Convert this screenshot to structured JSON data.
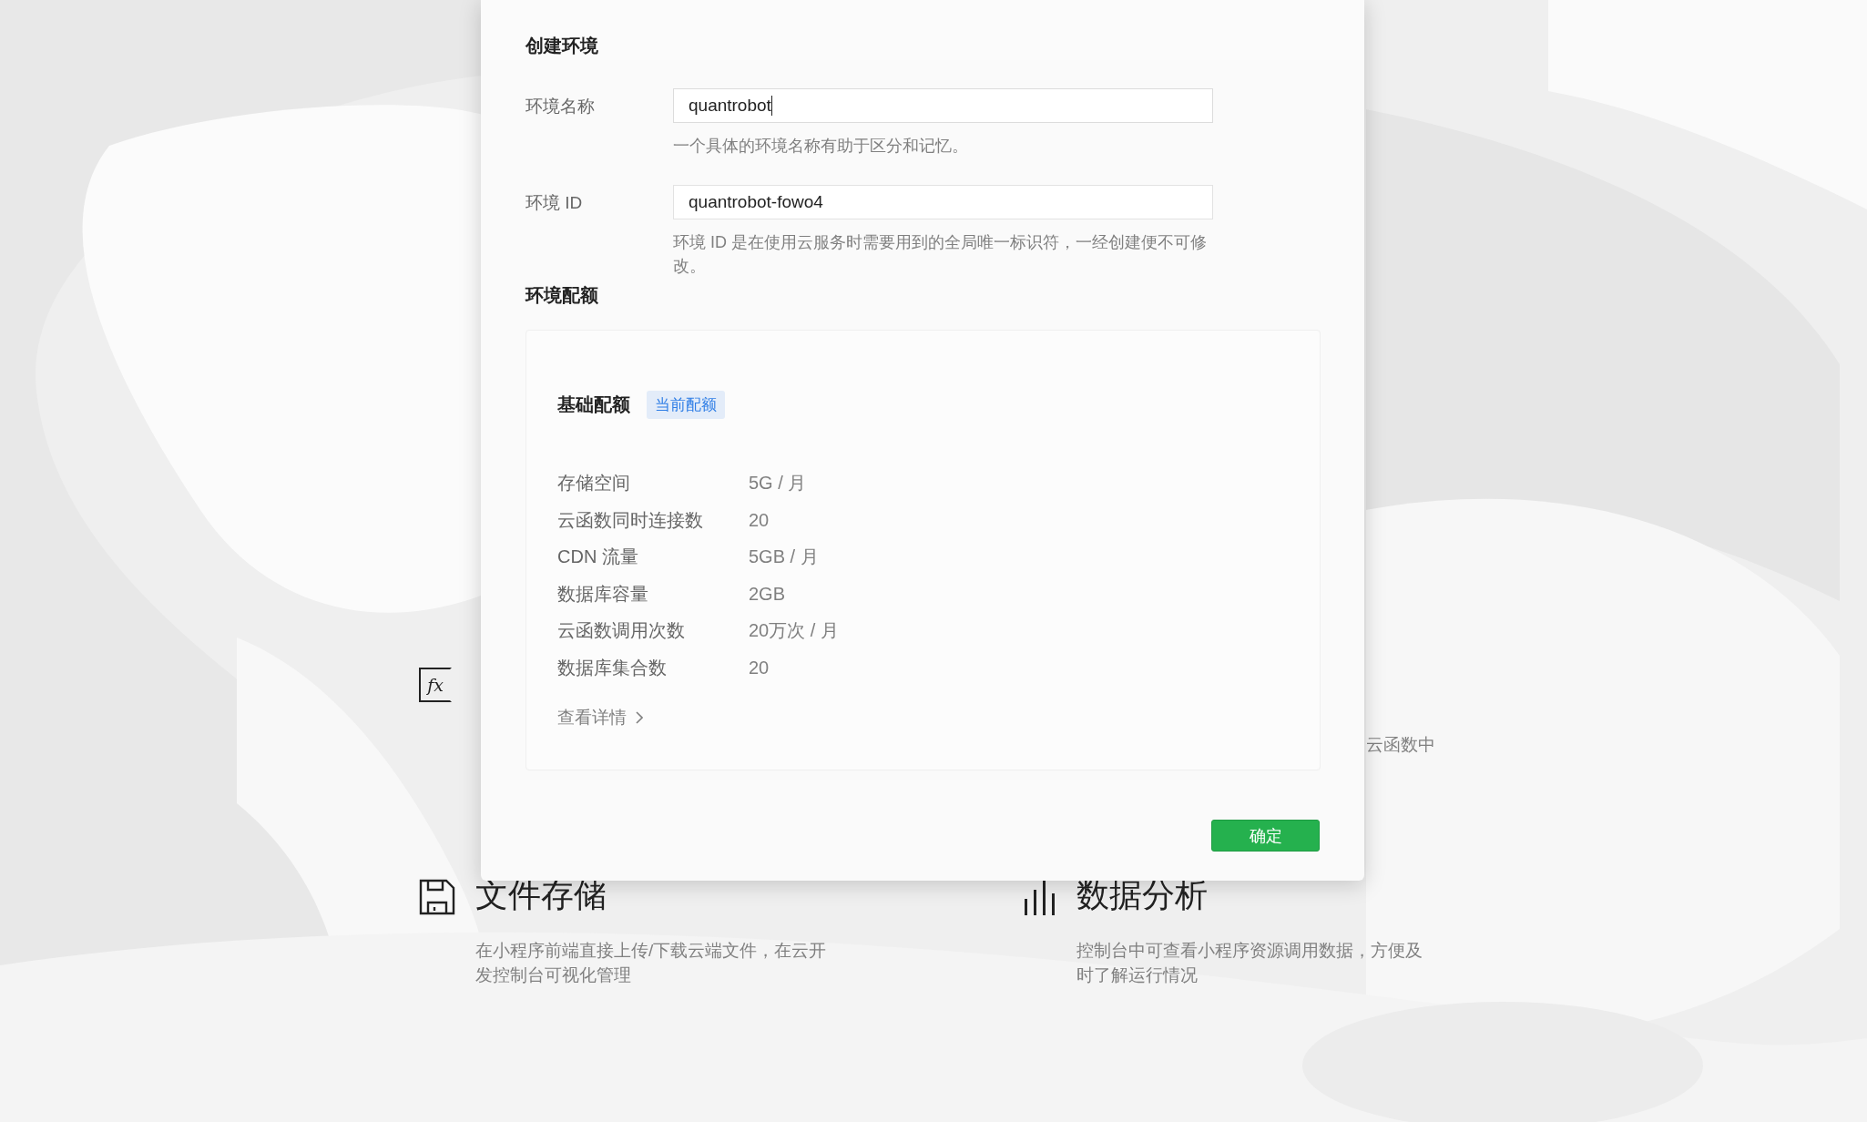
{
  "background": {
    "features": [
      {
        "kind": "function",
        "icon_text": "fx"
      },
      {
        "kind": "text",
        "description": [
          "云函数中"
        ]
      },
      {
        "kind": "storage",
        "title": "文件存储",
        "description": [
          "在小程序前端直接上传/下载云端文件，在云开",
          "发控制台可视化管理"
        ]
      },
      {
        "kind": "analytics",
        "title": "数据分析",
        "description": [
          "控制台中可查看小程序资源调用数据，方便及",
          "时了解运行情况"
        ]
      }
    ]
  },
  "dialog": {
    "title": "创建环境",
    "fields": [
      {
        "label": "环境名称",
        "value": "quantrobot",
        "focused": true,
        "hint": "一个具体的环境名称有助于区分和记忆。"
      },
      {
        "label": "环境 ID",
        "value": "quantrobot-fowo4",
        "focused": false,
        "hint": "环境 ID 是在使用云服务时需要用到的全局唯一标识符，一经创建便不可修改。"
      }
    ],
    "quota_section": "环境配额",
    "quota": {
      "title": "基础配额",
      "badge": "当前配额",
      "rows": [
        {
          "label": "存储空间",
          "value": "5G / 月"
        },
        {
          "label": "云函数同时连接数",
          "value": "20"
        },
        {
          "label": "CDN 流量",
          "value": "5GB / 月"
        },
        {
          "label": "数据库容量",
          "value": "2GB"
        },
        {
          "label": "云函数调用次数",
          "value": "20万次 / 月"
        },
        {
          "label": "数据库集合数",
          "value": "20"
        }
      ],
      "details_link": "查看详情"
    },
    "confirm_button": "确定"
  }
}
